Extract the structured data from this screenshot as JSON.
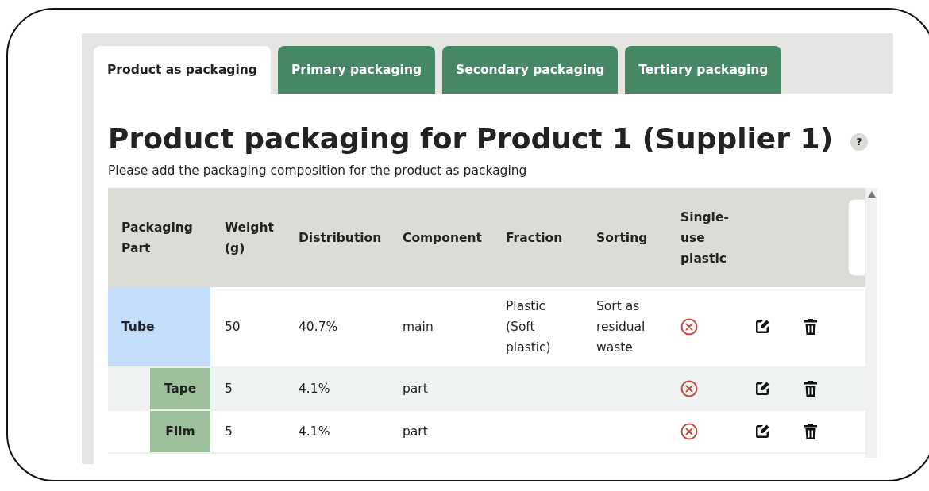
{
  "tabs": [
    {
      "label": "Product as packaging",
      "selected": true
    },
    {
      "label": "Primary packaging",
      "selected": false
    },
    {
      "label": "Secondary packaging",
      "selected": false
    },
    {
      "label": "Tertiary packaging",
      "selected": false
    }
  ],
  "title": "Product packaging for Product 1 (Supplier 1)",
  "help_icon": "?",
  "subtitle": "Please add the packaging composition for the product as packaging",
  "table": {
    "columns": [
      "Packaging Part",
      "Weight (g)",
      "Distribution",
      "Component",
      "Fraction",
      "Sorting",
      "Single-use plastic"
    ],
    "rows": [
      {
        "part": "Tube",
        "weight": "50",
        "distribution": "40.7%",
        "component": "main",
        "fraction": "Plastic (Soft plastic)",
        "sorting": "Sort as residual waste",
        "single_use_plastic": false,
        "children": [
          {
            "part": "Tape",
            "weight": "5",
            "distribution": "4.1%",
            "component": "part",
            "single_use_plastic": false,
            "highlighted": true
          },
          {
            "part": "Film",
            "weight": "5",
            "distribution": "4.1%",
            "component": "part",
            "single_use_plastic": false,
            "highlighted": false
          }
        ]
      }
    ]
  }
}
